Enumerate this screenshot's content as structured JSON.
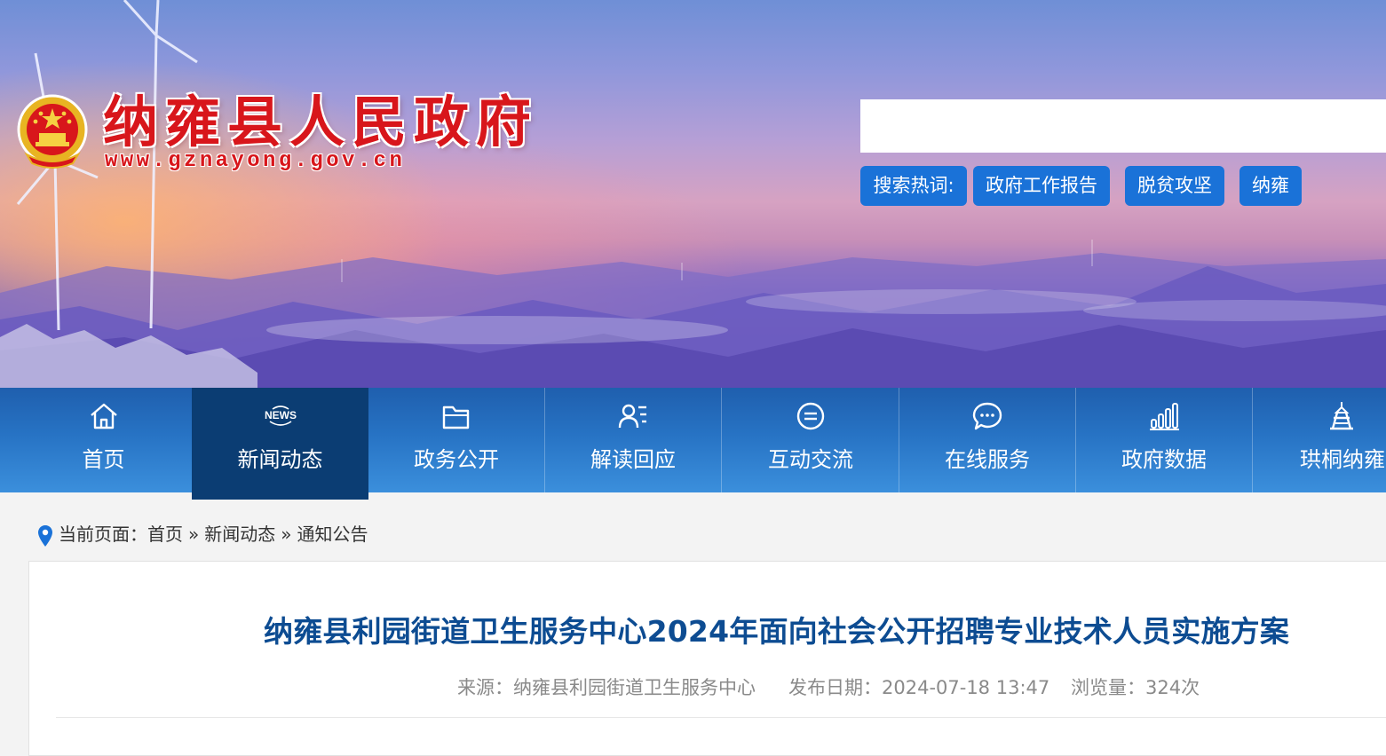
{
  "header": {
    "site_title": "纳雍县人民政府",
    "site_url": "www.gznayong.gov.cn",
    "search": {
      "placeholder": "",
      "value": ""
    },
    "hot_label": "搜索热词:",
    "hot_words": [
      "政府工作报告",
      "脱贫攻坚",
      "纳雍"
    ]
  },
  "nav": {
    "items": [
      {
        "label": "首页",
        "icon": "home-icon"
      },
      {
        "label": "新闻动态",
        "icon": "news-icon",
        "active": true
      },
      {
        "label": "政务公开",
        "icon": "folder-icon"
      },
      {
        "label": "解读回应",
        "icon": "interpret-icon"
      },
      {
        "label": "互动交流",
        "icon": "chat-icon"
      },
      {
        "label": "在线服务",
        "icon": "service-bubble-icon"
      },
      {
        "label": "政府数据",
        "icon": "bar-chart-icon"
      },
      {
        "label": "珙桐纳雍",
        "icon": "tower-icon"
      }
    ]
  },
  "breadcrumb": {
    "prefix": "当前页面：",
    "separator": "»",
    "items": [
      "首页",
      "新闻动态",
      "通知公告"
    ]
  },
  "article": {
    "title": "纳雍县利园街道卫生服务中心2024年面向社会公开招聘专业技术人员实施方案",
    "source": "来源：纳雍县利园街道卫生服务中心",
    "publish_date": "发布日期：2024-07-18 13:47",
    "views": "浏览量：324次"
  },
  "colors": {
    "title_red": "#d8161b",
    "hot_blue": "#1a72d8",
    "nav_blue": "#2773c4",
    "nav_active": "#0b3d73",
    "article_title": "#0d4c92"
  }
}
